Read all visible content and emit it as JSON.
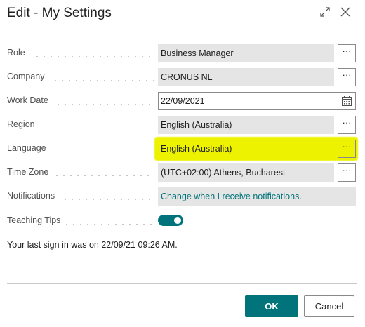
{
  "dialog": {
    "title": "Edit - My Settings"
  },
  "fields": {
    "role": {
      "label": "Role",
      "value": "Business Manager",
      "ellipsis": "···"
    },
    "company": {
      "label": "Company",
      "value": "CRONUS NL",
      "ellipsis": "···"
    },
    "work_date": {
      "label": "Work Date",
      "value": "22/09/2021"
    },
    "region": {
      "label": "Region",
      "value": "English (Australia)",
      "ellipsis": "···"
    },
    "language": {
      "label": "Language",
      "value": "English (Australia)",
      "ellipsis": "···"
    },
    "time_zone": {
      "label": "Time Zone",
      "value": "(UTC+02:00) Athens, Bucharest",
      "ellipsis": "···"
    },
    "notifications": {
      "label": "Notifications",
      "value": "Change when I receive notifications."
    },
    "teaching_tips": {
      "label": "Teaching Tips",
      "enabled": true
    }
  },
  "last_sign_in": "Your last sign in was on 22/09/21 09:26 AM.",
  "buttons": {
    "ok": "OK",
    "cancel": "Cancel"
  },
  "colors": {
    "accent": "#00747a",
    "highlight": "#ecf200",
    "field_bg": "#e5e5e5"
  }
}
